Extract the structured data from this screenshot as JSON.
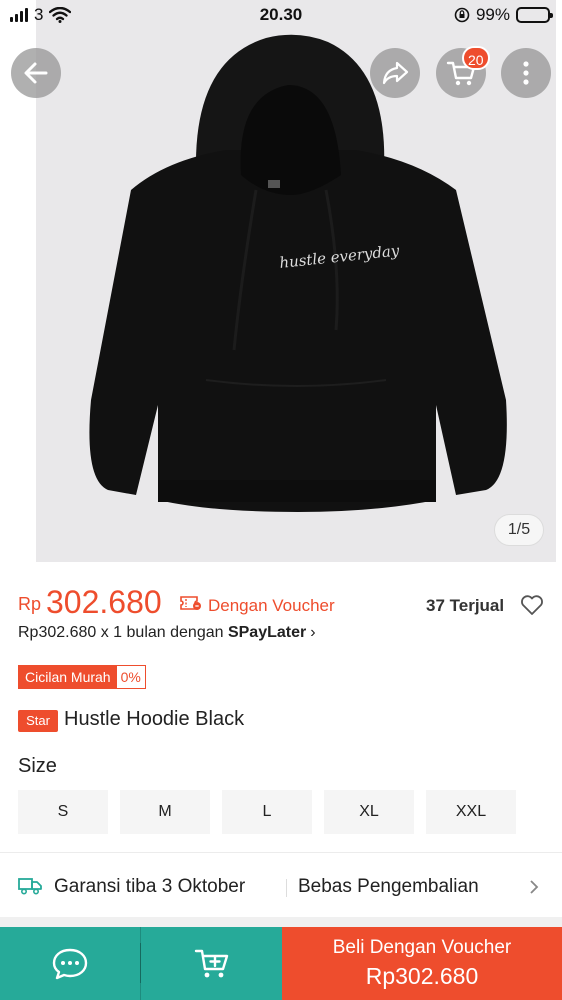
{
  "status_bar": {
    "carrier": "3",
    "time": "20.30",
    "battery_percent": "99%"
  },
  "product_image": {
    "counter": "1/5",
    "print_text": "hustle everyday"
  },
  "header_actions": {
    "cart_count": "20"
  },
  "price": {
    "currency": "Rp",
    "amount": "302.680",
    "voucher_label": "Dengan Voucher",
    "sold_label": "37 Terjual"
  },
  "installment": {
    "prefix": "Rp302.680 x 1 bulan dengan ",
    "brand": "SPayLater",
    "chevron": "›"
  },
  "cicilan_badge": {
    "label": "Cicilan Murah",
    "rate": "0%"
  },
  "product": {
    "badge": "Star",
    "title": "Hustle Hoodie Black"
  },
  "size": {
    "label": "Size",
    "options": [
      "S",
      "M",
      "L",
      "XL",
      "XXL"
    ]
  },
  "shipping": {
    "guarantee": "Garansi tiba 3 Oktober",
    "returns": "Bebas Pengembalian"
  },
  "bottom_bar": {
    "buy_label": "Beli Dengan Voucher",
    "buy_price": "Rp302.680"
  },
  "colors": {
    "brand_orange": "#ee4d2d",
    "teal": "#26aa99"
  }
}
